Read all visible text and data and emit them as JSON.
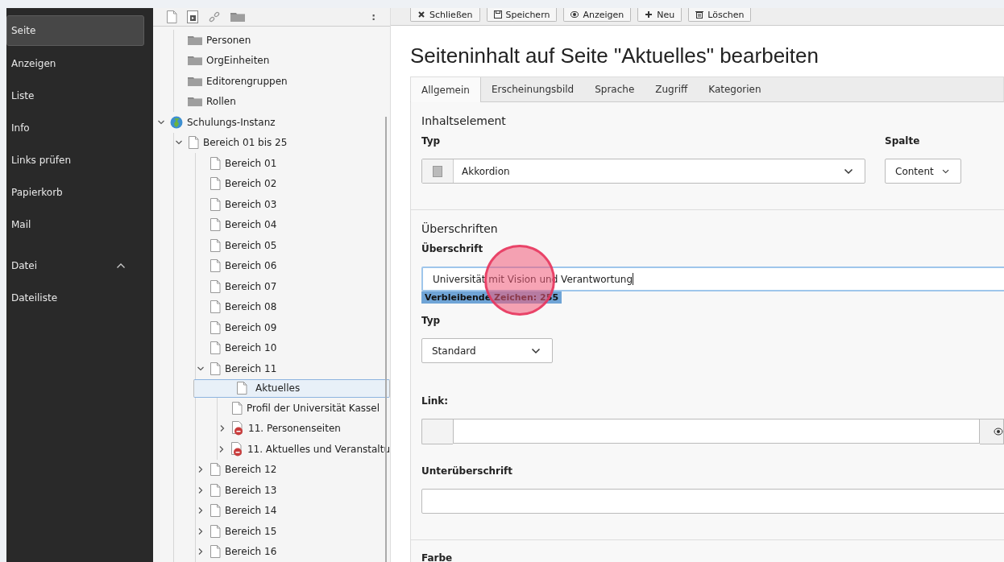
{
  "modules": [
    {
      "kind": "module",
      "label": "Seite",
      "selected": true
    },
    {
      "kind": "module",
      "label": "Anzeigen",
      "selected": false
    },
    {
      "kind": "module",
      "label": "Liste",
      "selected": false
    },
    {
      "kind": "module",
      "label": "Info",
      "selected": false
    },
    {
      "kind": "module",
      "label": "Links prüfen",
      "selected": false
    },
    {
      "kind": "module",
      "label": "Papierkorb",
      "selected": false
    },
    {
      "kind": "module",
      "label": "Mail",
      "selected": false
    },
    {
      "kind": "group",
      "label": "Datei",
      "expanded": true,
      "selected": false
    },
    {
      "kind": "module",
      "label": "Dateiliste",
      "selected": false
    }
  ],
  "page_tree": {
    "toolbar": [
      {
        "kind": "page"
      },
      {
        "kind": "page-import"
      },
      {
        "kind": "link"
      },
      {
        "kind": "folder"
      }
    ],
    "menu": ":",
    "items": [
      {
        "children": [
          {
            "kind": "folder",
            "label": "Personen",
            "selected": false
          },
          {
            "kind": "folder",
            "label": "OrgEinheiten",
            "selected": false
          },
          {
            "kind": "folder",
            "label": "Editorengruppen",
            "selected": false
          },
          {
            "kind": "folder",
            "label": "Rollen",
            "selected": false
          }
        ]
      },
      {
        "kind": "globe",
        "label": "Schulungs-Instanz",
        "expanded": true,
        "selected": false,
        "children": [
          {
            "kind": "page",
            "label": "Bereich 01 bis 25",
            "expanded": true,
            "selected": false,
            "children": [
              {
                "kind": "page",
                "label": "Bereich 01",
                "selected": false
              },
              {
                "kind": "page",
                "label": "Bereich 02",
                "selected": false
              },
              {
                "kind": "page",
                "label": "Bereich 03",
                "selected": false
              },
              {
                "kind": "page",
                "label": "Bereich 04",
                "selected": false
              },
              {
                "kind": "page",
                "label": "Bereich 05",
                "selected": false
              },
              {
                "kind": "page",
                "label": "Bereich 06",
                "selected": false
              },
              {
                "kind": "page",
                "label": "Bereich 07",
                "selected": false
              },
              {
                "kind": "page",
                "label": "Bereich 08",
                "selected": false
              },
              {
                "kind": "page",
                "label": "Bereich 09",
                "selected": false
              },
              {
                "kind": "page",
                "label": "Bereich 10",
                "selected": false
              },
              {
                "kind": "page",
                "label": "Bereich 11",
                "expanded": true,
                "selected": false,
                "children": [
                  {
                    "kind": "page",
                    "label": "Aktuelles",
                    "selected": true
                  },
                  {
                    "kind": "page",
                    "label": "Profil der Universität Kassel",
                    "selected": false
                  },
                  {
                    "kind": "restricted",
                    "label": "11. Personenseiten",
                    "expanded": false,
                    "selected": false
                  },
                  {
                    "kind": "restricted",
                    "label": "11. Aktuelles und Veranstaltu",
                    "expanded": false,
                    "selected": false
                  }
                ]
              },
              {
                "kind": "page",
                "label": "Bereich 12",
                "expanded": false,
                "selected": false
              },
              {
                "kind": "page",
                "label": "Bereich 13",
                "expanded": false,
                "selected": false
              },
              {
                "kind": "page",
                "label": "Bereich 14",
                "expanded": false,
                "selected": false
              },
              {
                "kind": "page",
                "label": "Bereich 15",
                "expanded": false,
                "selected": false
              },
              {
                "kind": "page",
                "label": "Bereich 16",
                "expanded": false,
                "selected": false
              }
            ]
          }
        ]
      }
    ]
  },
  "toolbar": [
    {
      "kind": "close",
      "label": "Schließen"
    },
    {
      "kind": "save",
      "label": "Speichern"
    },
    {
      "kind": "view",
      "label": "Anzeigen"
    },
    {
      "kind": "new",
      "label": "Neu"
    },
    {
      "kind": "delete",
      "label": "Löschen"
    }
  ],
  "heading": "Seiteninhalt auf Seite \"Aktuelles\" bearbeiten",
  "tabs": [
    {
      "label": "Allgemein",
      "selected": true
    },
    {
      "label": "Erscheinungsbild",
      "selected": false
    },
    {
      "label": "Sprache",
      "selected": false
    },
    {
      "label": "Zugriff",
      "selected": false
    },
    {
      "label": "Kategorien",
      "selected": false
    }
  ],
  "sections": [
    {
      "title": "Inhaltselement",
      "fields": [
        {
          "kind": "select-icon",
          "label": "Typ",
          "value": "Akkordion"
        },
        {
          "kind": "select-small",
          "label": "Spalte",
          "value": "Content"
        }
      ]
    },
    {
      "title": "Überschriften",
      "fields": [
        {
          "kind": "text",
          "label": "Überschrift",
          "value": "Universität mit Vision und Verantwortung",
          "focused": true,
          "counter": "Verbleibende Zeichen: 255"
        },
        {
          "kind": "select",
          "label": "Typ",
          "value": "Standard"
        },
        {
          "kind": "link",
          "label": "Link:"
        },
        {
          "kind": "text",
          "label": "Unterüberschrift",
          "focused": false
        }
      ]
    },
    {
      "title_label": "Farbe"
    }
  ],
  "click_marker": {
    "visible": true
  }
}
